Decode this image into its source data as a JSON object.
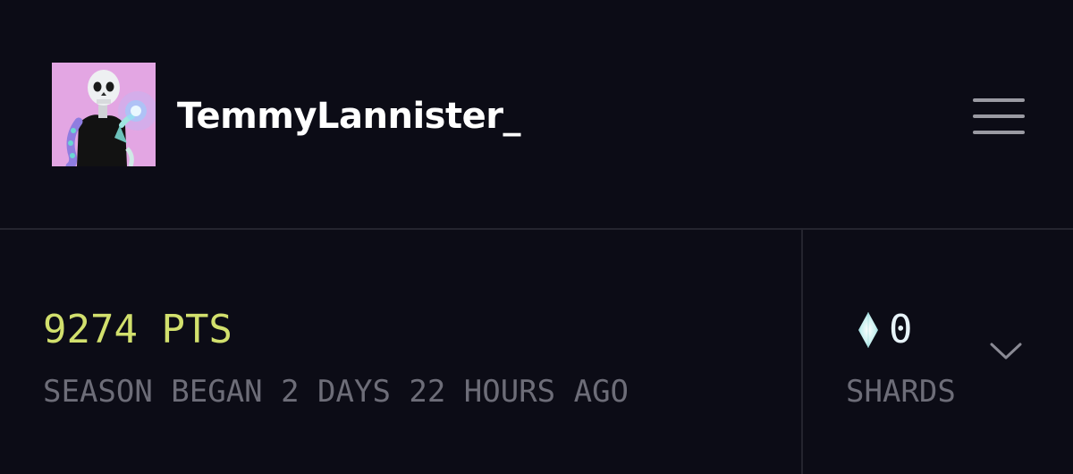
{
  "profile": {
    "username": "TemmyLannister_",
    "avatar_icon": "skeleton-avatar-icon"
  },
  "header": {
    "menu_icon": "hamburger-menu-icon"
  },
  "stats": {
    "points": "9274 PTS",
    "season_text": "SEASON BEGAN 2 DAYS 22 HOURS AGO",
    "shards_count": "0",
    "shards_label": "SHARDS",
    "shard_icon": "crystal-shard-icon",
    "expand_icon": "chevron-down-icon"
  },
  "colors": {
    "background": "#0c0c16",
    "points_color": "#d2e06d",
    "muted_text": "#6d6d78",
    "divider": "#25252f"
  }
}
